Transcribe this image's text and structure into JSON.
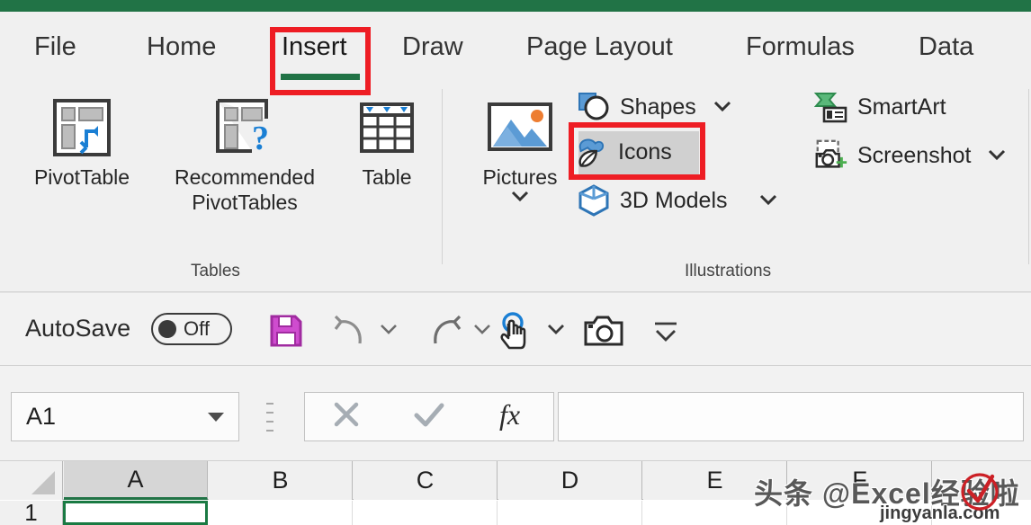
{
  "window": {
    "title_bar_color": "#217346",
    "ribbon_bg": "#f0f0f0",
    "accent_green": "#217346",
    "highlight_red": "#ee1d24"
  },
  "tabs": [
    {
      "label": "File",
      "active": false
    },
    {
      "label": "Home",
      "active": false
    },
    {
      "label": "Insert",
      "active": true
    },
    {
      "label": "Draw",
      "active": false
    },
    {
      "label": "Page Layout",
      "active": false
    },
    {
      "label": "Formulas",
      "active": false
    },
    {
      "label": "Data",
      "active": false
    }
  ],
  "ribbon": {
    "groups": [
      {
        "name": "Tables",
        "label": "Tables",
        "big_buttons": [
          {
            "label": "PivotTable",
            "icon": "pivottable-icon"
          },
          {
            "label": "Recommended\nPivotTables",
            "icon": "recommended-pivottables-icon"
          },
          {
            "label": "Table",
            "icon": "table-icon"
          }
        ]
      },
      {
        "name": "Illustrations",
        "label": "Illustrations",
        "big_buttons": [
          {
            "label": "Pictures",
            "icon": "pictures-icon",
            "has_dropdown": true
          }
        ],
        "small_buttons": [
          {
            "label": "Shapes",
            "icon": "shapes-icon",
            "has_dropdown": true,
            "highlighted": false
          },
          {
            "label": "Icons",
            "icon": "icons-icon",
            "has_dropdown": false,
            "highlighted": true
          },
          {
            "label": "3D Models",
            "icon": "3d-models-icon",
            "has_dropdown": true,
            "highlighted": false
          },
          {
            "label": "SmartArt",
            "icon": "smartart-icon",
            "has_dropdown": false,
            "highlighted": false
          },
          {
            "label": "Screenshot",
            "icon": "screenshot-icon",
            "has_dropdown": true,
            "highlighted": false
          }
        ]
      }
    ]
  },
  "quick_access": {
    "autosave_label": "AutoSave",
    "autosave_state": "Off",
    "buttons": [
      {
        "name": "save-button",
        "icon": "save-icon",
        "has_dropdown": false
      },
      {
        "name": "undo-button",
        "icon": "undo-icon",
        "has_dropdown": true
      },
      {
        "name": "redo-button",
        "icon": "redo-icon",
        "has_dropdown": true
      },
      {
        "name": "touch-mouse-mode",
        "icon": "touch-mode-icon",
        "has_dropdown": true
      },
      {
        "name": "screenshot-tool",
        "icon": "camera-icon",
        "has_dropdown": false
      },
      {
        "name": "customize-toolbar",
        "icon": "overflow-icon",
        "has_dropdown": false
      }
    ]
  },
  "formula_bar": {
    "name_box_value": "A1",
    "cancel_icon": "cancel-x-icon",
    "enter_icon": "enter-check-icon",
    "function_icon": "insert-function-icon",
    "formula_value": ""
  },
  "grid": {
    "columns": [
      "A",
      "B",
      "C",
      "D",
      "E",
      "F"
    ],
    "selected_column": "A",
    "rows": [
      "1"
    ],
    "active_cell": "A1"
  },
  "watermark": {
    "main": "头条 @Excel经验啦",
    "sub": "jingyanla.com"
  }
}
